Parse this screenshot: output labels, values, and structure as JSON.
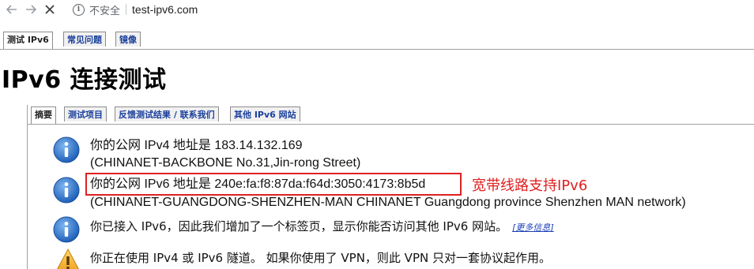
{
  "browser": {
    "security_label": "不安全",
    "url": "test-ipv6.com"
  },
  "tabs": [
    "测试 IPv6",
    "常见问题",
    "镜像"
  ],
  "page": {
    "title": "IPv6 连接测试"
  },
  "subtabs": [
    "摘要",
    "测试项目",
    "反馈测试结果 / 联系我们",
    "其他 IPv6 网站"
  ],
  "rows": [
    {
      "icon": "info-icon",
      "line1": "你的公网 IPv4 地址是 183.14.132.169",
      "line2": "(CHINANET-BACKBONE No.31,Jin-rong Street)"
    },
    {
      "icon": "info-icon",
      "line1": "你的公网 IPv6 地址是 240e:fa:f8:87da:f64d:3050:4173:8b5d",
      "line2": "(CHINANET-GUANGDONG-SHENZHEN-MAN CHINANET Guangdong province Shenzhen MAN network)"
    },
    {
      "icon": "info-icon",
      "text": "你已接入 IPv6，因此我们增加了一个标签页，显示你能否访问其他 IPv6 网站。",
      "link": "[更多信息]"
    },
    {
      "icon": "warning-icon",
      "text": "你正在使用 IPv4 或 IPv6 隧道。 如果你使用了 VPN，则此 VPN 只对一套协议起作用。"
    }
  ],
  "annotation": "宽带线路支持IPv6",
  "colors": {
    "annotation": "#e02020",
    "link": "#1a3fb8",
    "tab_text": "#1a3f9c",
    "info_icon": "#1e5fb8",
    "warning_icon": "#f0a020"
  }
}
